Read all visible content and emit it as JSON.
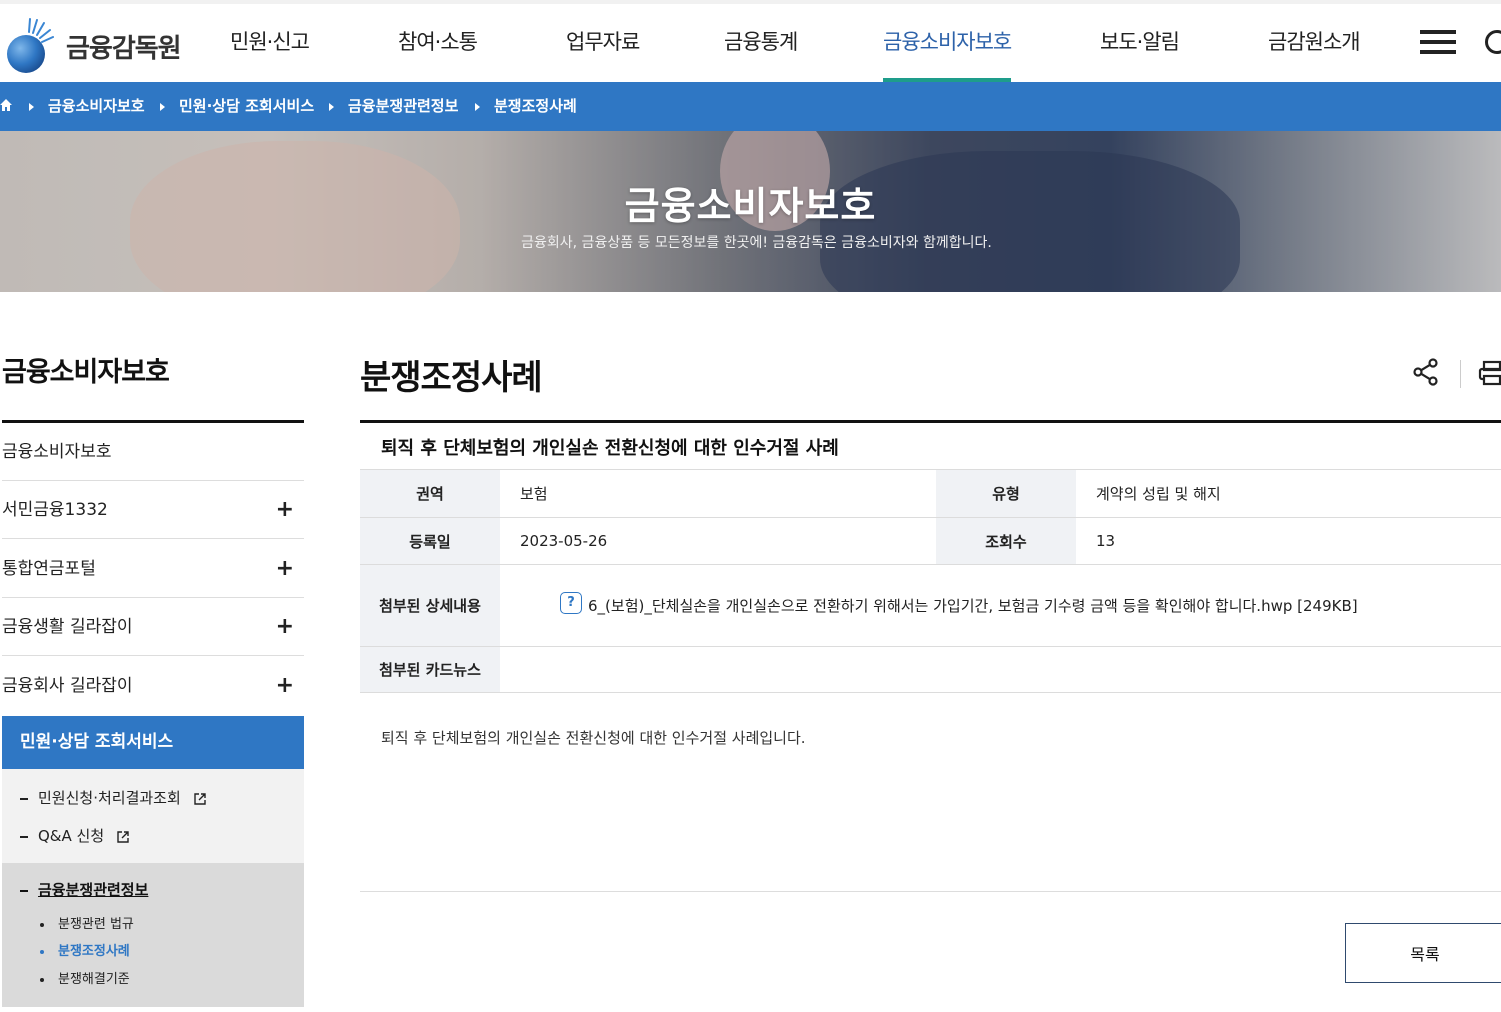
{
  "header": {
    "logo_text": "금융감독원",
    "menu": [
      {
        "label": "민원·신고"
      },
      {
        "label": "참여·소통"
      },
      {
        "label": "업무자료"
      },
      {
        "label": "금융통계"
      },
      {
        "label": "금융소비자보호",
        "active": true
      },
      {
        "label": "보도·알림"
      },
      {
        "label": "금감원소개"
      }
    ],
    "accent_color": "#2d62a9",
    "underline_color": "#1e9d8b"
  },
  "breadcrumb": {
    "bar_color": "#2f77c4",
    "items": [
      "금융소비자보호",
      "민원·상담 조회서비스",
      "금융분쟁관련정보",
      "분쟁조정사례"
    ]
  },
  "hero": {
    "title": "금융소비자보호",
    "subtitle": "금융회사, 금융상품 등 모든정보를 한곳에! 금융감독은 금융소비자와 함께합니다."
  },
  "sidebar": {
    "title": "금융소비자보호",
    "items": [
      {
        "label": "금융소비자보호"
      },
      {
        "label": "서민금융1332"
      },
      {
        "label": "통합연금포털"
      },
      {
        "label": "금융생활 길라잡이"
      },
      {
        "label": "금융회사 길라잡이"
      }
    ],
    "active_section": "민원·상담 조회서비스",
    "sub_links": [
      "민원신청·처리결과조회",
      "Q&A 신청"
    ],
    "current_group": "금융분쟁관련정보",
    "group_items": [
      "분쟁관련 법규",
      "분쟁조정사례",
      "분쟁해결기준"
    ]
  },
  "main": {
    "page_title": "분쟁조정사례",
    "post_title": "퇴직 후 단체보험의 개인실손 전환신청에 대한 인수거절 사례",
    "table": {
      "region_label": "권역",
      "region_value": "보험",
      "type_label": "유형",
      "type_value": "계약의 성립 및 해지",
      "date_label": "등록일",
      "date_value": "2023-05-26",
      "views_label": "조회수",
      "views_value": "13",
      "attach_label": "첨부된 상세내용",
      "attach_file": "6_(보험)_단체실손을 개인실손으로 전환하기 위해서는 가입기간, 보험금 기수령 금액 등을 확인해야 합니다.hwp [249KB]",
      "cardnews_label": "첨부된 카드뉴스",
      "cardnews_value": ""
    },
    "summary": "퇴직 후 단체보험의 개인실손 전환신청에 대한 인수거절 사례입니다.",
    "list_button": "목록"
  }
}
